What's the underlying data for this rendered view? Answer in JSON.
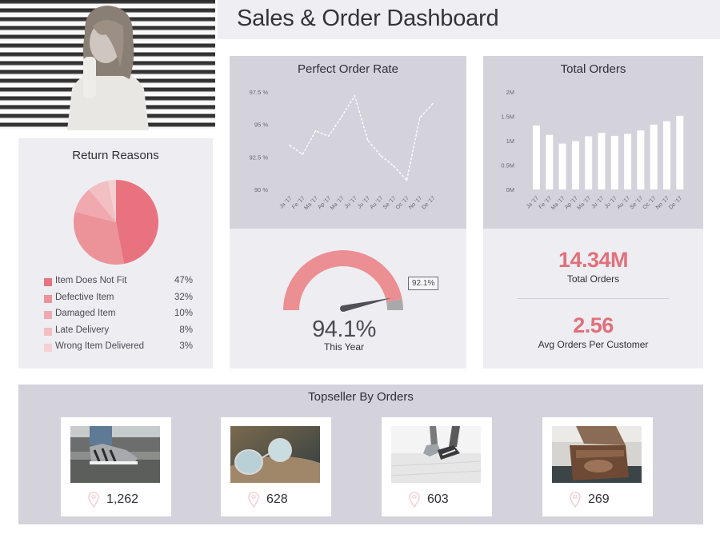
{
  "header": {
    "title": "Sales & Order Dashboard"
  },
  "hero_image": {
    "alt": "woman-portrait-photo"
  },
  "return_reasons": {
    "title": "Return Reasons",
    "items": [
      {
        "label": "Item Does Not Fit",
        "value": "47%",
        "pct": 47,
        "color": "#e8737f"
      },
      {
        "label": "Defective Item",
        "value": "32%",
        "pct": 32,
        "color": "#ec939a"
      },
      {
        "label": "Damaged Item",
        "value": "10%",
        "pct": 10,
        "color": "#f0a9ae"
      },
      {
        "label": "Late Delivery",
        "value": "8%",
        "pct": 8,
        "color": "#f2bfc2"
      },
      {
        "label": "Wrong Item Delivered",
        "value": "3%",
        "pct": 3,
        "color": "#f5d0d2"
      }
    ]
  },
  "perfect_order": {
    "title": "Perfect Order Rate",
    "gauge": {
      "value_label": "94.1%",
      "sub_label": "This Year",
      "target_label": "92.1%",
      "value_pct": 94.1,
      "target_pct": 92.1,
      "colors": {
        "fill": "#eb8f93",
        "remainder": "#a9a9ab",
        "needle": "#4f4f55"
      }
    }
  },
  "total_orders": {
    "title": "Total Orders",
    "kpis": [
      {
        "value": "14.34M",
        "label": "Total Orders"
      },
      {
        "value": "2.56",
        "label": "Avg Orders Per Customer"
      }
    ]
  },
  "topseller": {
    "title": "Topseller By Orders",
    "items": [
      {
        "product": "sneakers",
        "count": "1,262"
      },
      {
        "product": "sunglasses",
        "count": "628"
      },
      {
        "product": "running-shoes",
        "count": "603"
      },
      {
        "product": "leather-bag",
        "count": "269"
      }
    ]
  },
  "colors": {
    "accent": "#e0707b",
    "panel_gray": "#d4d2db",
    "panel_light": "#eeedf2",
    "header_bg": "#efeef2"
  },
  "chart_data": [
    {
      "type": "line",
      "title": "Perfect Order Rate",
      "categories": [
        "Ja '17",
        "Fe '17",
        "Ma '17",
        "Ap '17",
        "Ma '17",
        "Ju '17",
        "Ju '17",
        "Au '17",
        "Se '17",
        "Oc '17",
        "No '17",
        "De '17"
      ],
      "series": [
        {
          "name": "Perfect Order Rate",
          "values": [
            93.4,
            92.7,
            94.5,
            94.1,
            95.6,
            97.2,
            93.8,
            92.6,
            91.8,
            90.7,
            95.5,
            96.6
          ]
        }
      ],
      "yticks": [
        "90 %",
        "92.5 %",
        "95 %",
        "97.5 %"
      ],
      "ytick_values": [
        90,
        92.5,
        95,
        97.5
      ],
      "ylim": [
        90,
        97.5
      ],
      "xlabel": "",
      "ylabel": "",
      "grid": false,
      "line_style": "dashed",
      "line_color": "#ffffff"
    },
    {
      "type": "bar",
      "title": "Total Orders",
      "categories": [
        "Ja '17",
        "Fe '17",
        "Ma '17",
        "Ap '17",
        "Ma '17",
        "Ju '17",
        "Ju '17",
        "Au '17",
        "Se '17",
        "Oc '17",
        "No '17",
        "De '17"
      ],
      "values": [
        1.31,
        1.12,
        0.94,
        0.99,
        1.09,
        1.16,
        1.1,
        1.14,
        1.21,
        1.33,
        1.4,
        1.51
      ],
      "unit": "M",
      "yticks": [
        "0M",
        "0.5M",
        "1M",
        "1.5M",
        "2M"
      ],
      "ytick_values": [
        0,
        0.5,
        1,
        1.5,
        2
      ],
      "ylim": [
        0,
        2
      ],
      "xlabel": "",
      "ylabel": "",
      "grid": false,
      "bar_color": "#ffffff"
    },
    {
      "type": "pie",
      "title": "Return Reasons",
      "categories": [
        "Item Does Not Fit",
        "Defective Item",
        "Damaged Item",
        "Late Delivery",
        "Wrong Item Delivered"
      ],
      "values": [
        47,
        32,
        10,
        8,
        3
      ],
      "legend": "bottom"
    }
  ]
}
